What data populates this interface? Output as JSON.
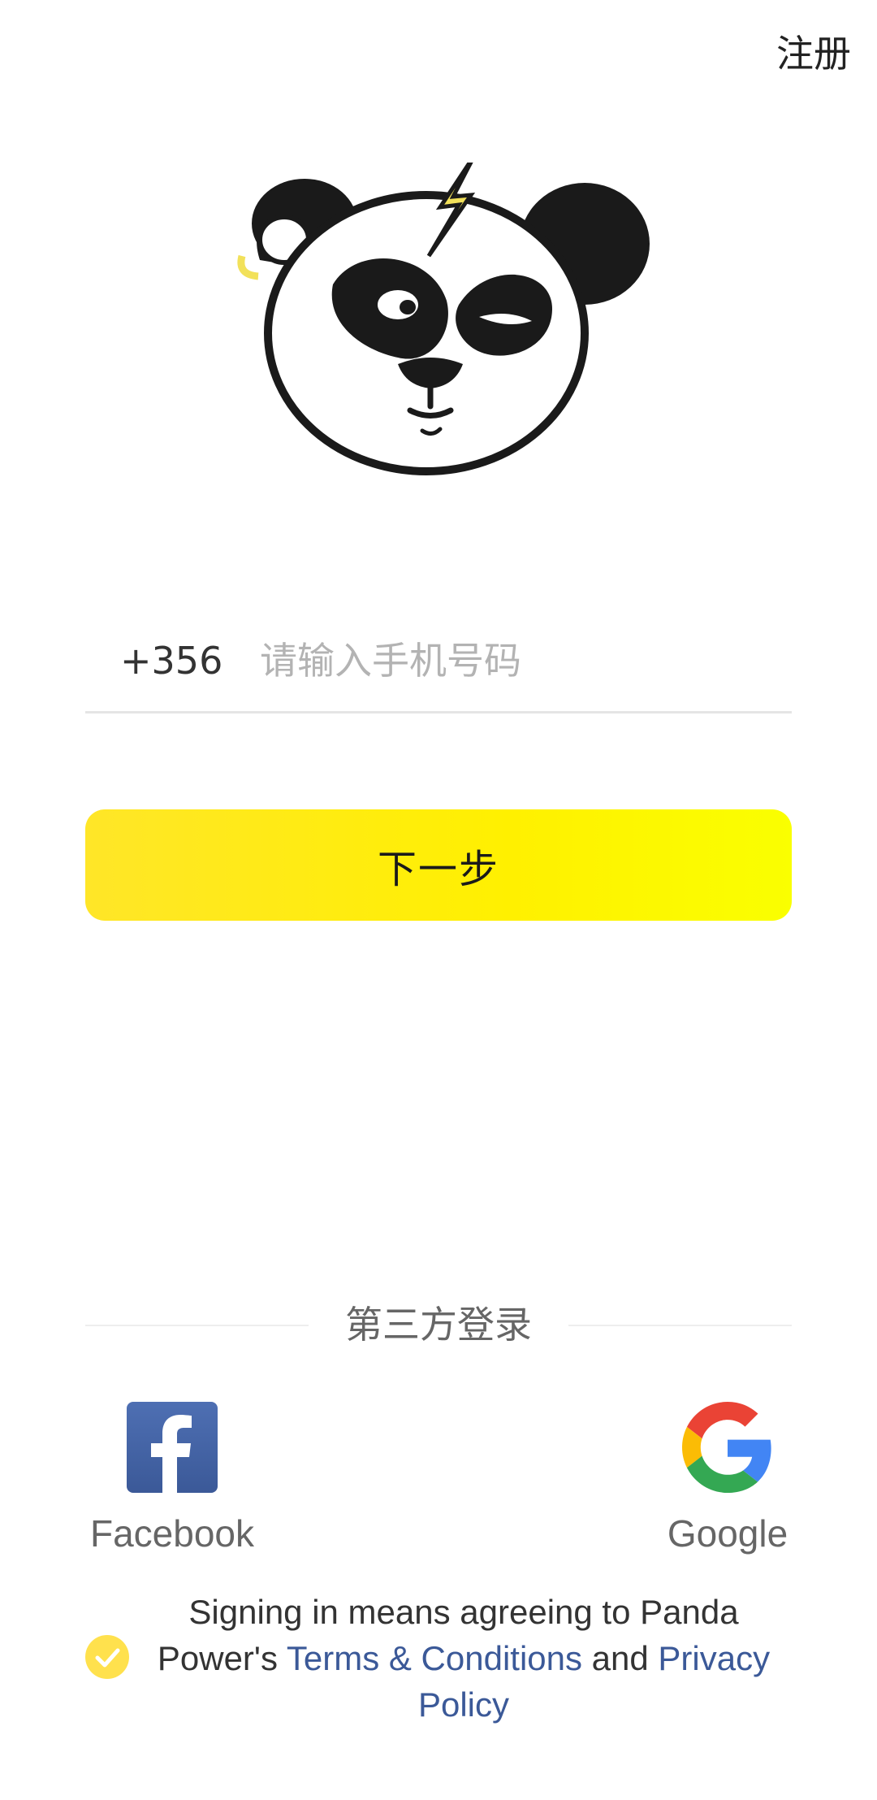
{
  "header": {
    "register_label": "注册"
  },
  "login_form": {
    "country_code": "+356",
    "phone_placeholder": "请输入手机号码",
    "phone_value": "",
    "next_label": "下一步"
  },
  "third_party": {
    "divider_label": "第三方登录",
    "providers": [
      {
        "label": "Facebook",
        "icon": "facebook-icon"
      },
      {
        "label": "Google",
        "icon": "google-icon"
      }
    ]
  },
  "terms": {
    "checked": true,
    "text_before": "Signing in means agreeing to Panda Power's ",
    "terms_link": "Terms & Conditions",
    "text_between": " and ",
    "privacy_link": "Privacy Policy"
  },
  "colors": {
    "accent_yellow": "#FFEB1F",
    "link_blue": "#3B5998",
    "facebook_blue": "#3B5998"
  }
}
